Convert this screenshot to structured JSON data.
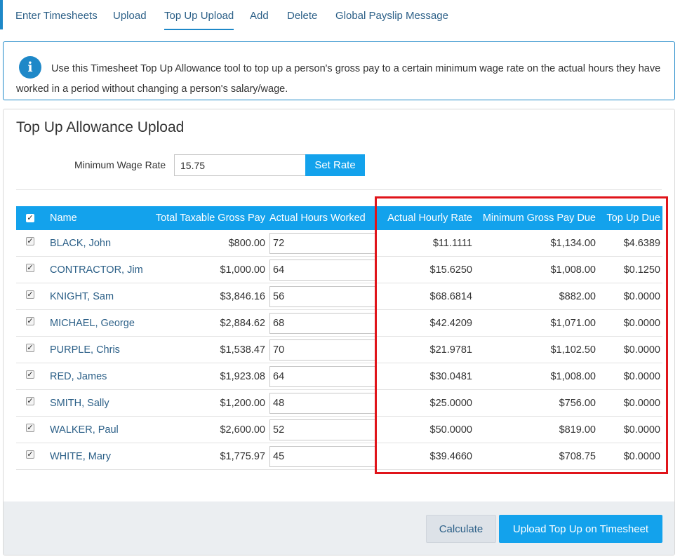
{
  "tabs": [
    {
      "label": "Enter Timesheets"
    },
    {
      "label": "Upload"
    },
    {
      "label": "Top Up Upload"
    },
    {
      "label": "Add"
    },
    {
      "label": "Delete"
    },
    {
      "label": "Global Payslip Message"
    }
  ],
  "info": {
    "text": "Use this Timesheet Top Up Allowance tool to top up a person's gross pay to a certain minimum wage rate on the actual hours they have worked in a period without changing a person's salary/wage."
  },
  "panel": {
    "title": "Top Up Allowance Upload",
    "rate_label": "Minimum Wage Rate",
    "rate_value": "15.75",
    "set_rate_label": "Set Rate"
  },
  "table": {
    "headers": {
      "name": "Name",
      "gross": "Total Taxable Gross Pay",
      "hours": "Actual Hours Worked",
      "rate": "Actual Hourly Rate",
      "min": "Minimum Gross Pay Due",
      "top": "Top Up Due"
    },
    "rows": [
      {
        "name": "BLACK, John",
        "gross": "$800.00",
        "hours": "72",
        "rate": "$11.1111",
        "min": "$1,134.00",
        "top": "$4.6389"
      },
      {
        "name": "CONTRACTOR, Jim",
        "gross": "$1,000.00",
        "hours": "64",
        "rate": "$15.6250",
        "min": "$1,008.00",
        "top": "$0.1250"
      },
      {
        "name": "KNIGHT, Sam",
        "gross": "$3,846.16",
        "hours": "56",
        "rate": "$68.6814",
        "min": "$882.00",
        "top": "$0.0000"
      },
      {
        "name": "MICHAEL, George",
        "gross": "$2,884.62",
        "hours": "68",
        "rate": "$42.4209",
        "min": "$1,071.00",
        "top": "$0.0000"
      },
      {
        "name": "PURPLE, Chris",
        "gross": "$1,538.47",
        "hours": "70",
        "rate": "$21.9781",
        "min": "$1,102.50",
        "top": "$0.0000"
      },
      {
        "name": "RED, James",
        "gross": "$1,923.08",
        "hours": "64",
        "rate": "$30.0481",
        "min": "$1,008.00",
        "top": "$0.0000"
      },
      {
        "name": "SMITH, Sally",
        "gross": "$1,200.00",
        "hours": "48",
        "rate": "$25.0000",
        "min": "$756.00",
        "top": "$0.0000"
      },
      {
        "name": "WALKER, Paul",
        "gross": "$2,600.00",
        "hours": "52",
        "rate": "$50.0000",
        "min": "$819.00",
        "top": "$0.0000"
      },
      {
        "name": "WHITE, Mary",
        "gross": "$1,775.97",
        "hours": "45",
        "rate": "$39.4660",
        "min": "$708.75",
        "top": "$0.0000"
      }
    ]
  },
  "footer": {
    "calculate_label": "Calculate",
    "upload_label": "Upload Top Up on Timesheet"
  },
  "colors": {
    "accent": "#13a2ec",
    "link": "#2b5f87",
    "highlight": "#e0141a"
  }
}
